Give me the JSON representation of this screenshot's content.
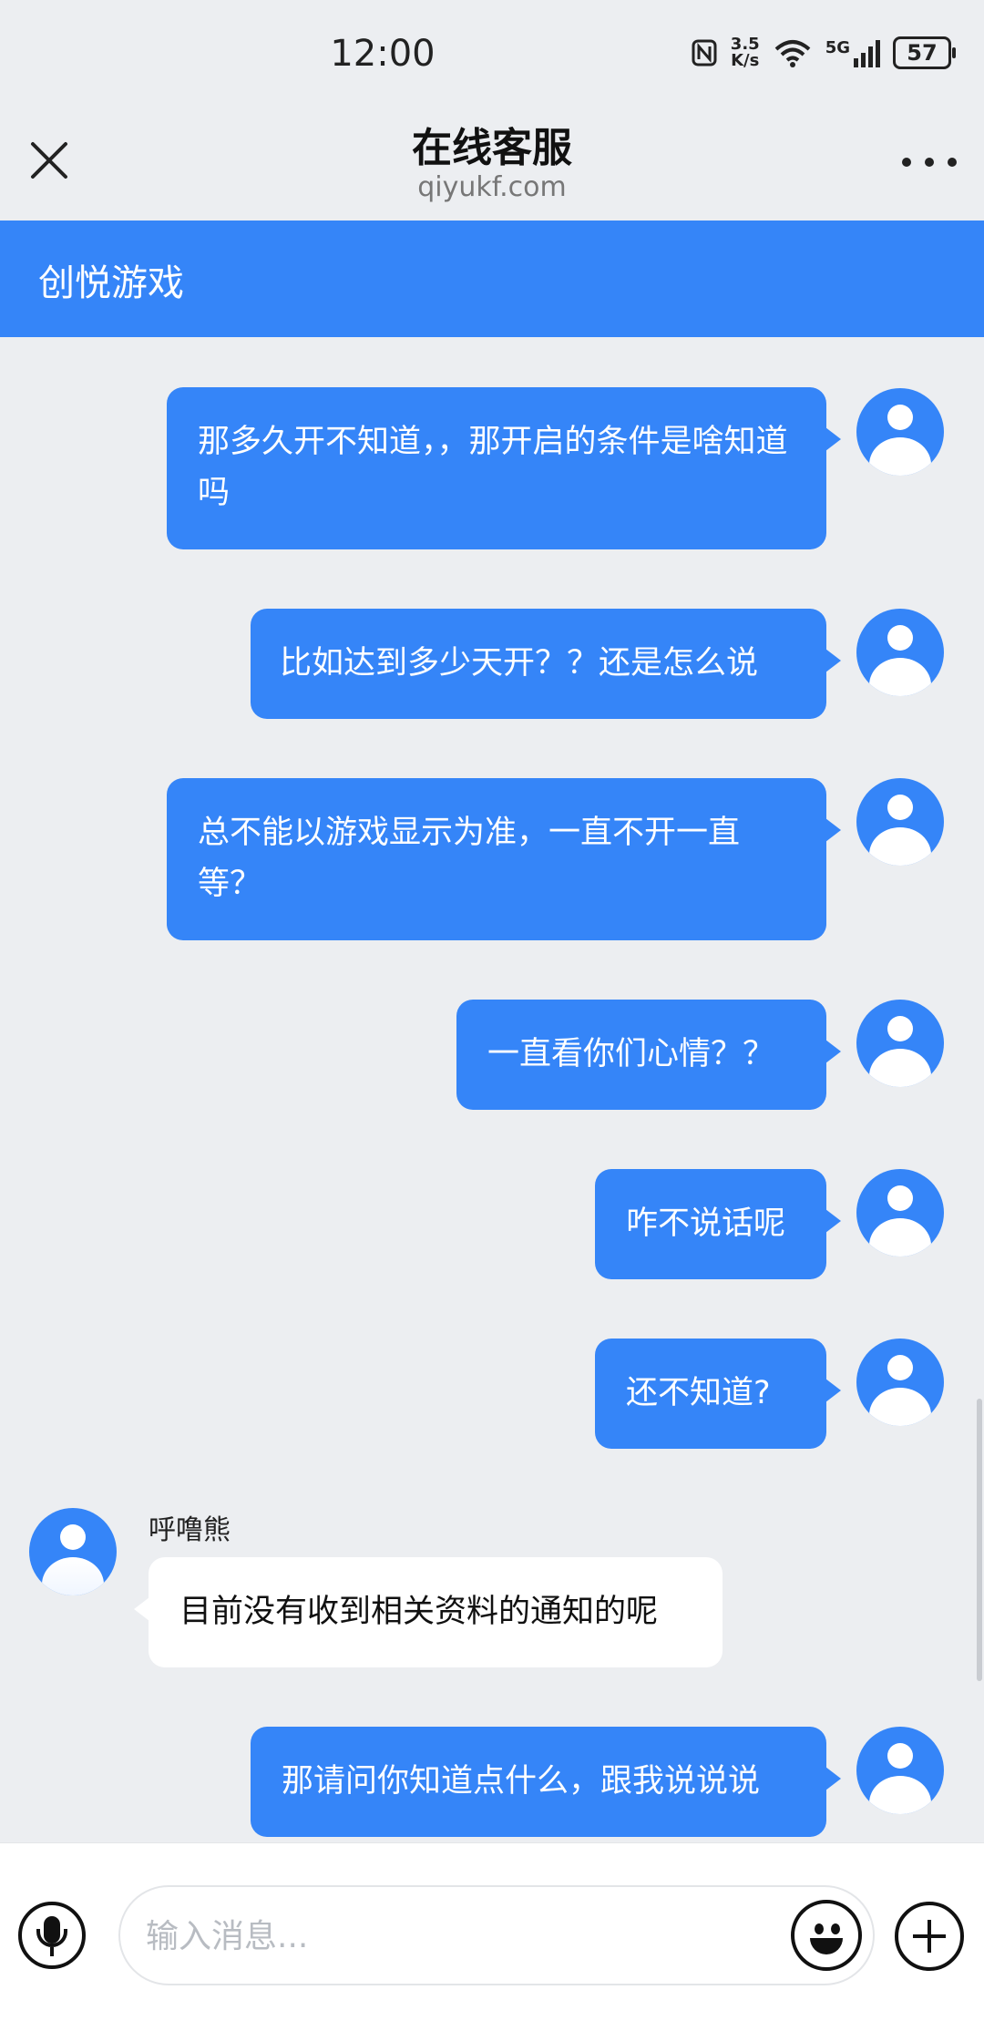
{
  "status_bar": {
    "time": "12:00",
    "net_speed_value": "3.5",
    "net_speed_unit": "K/s",
    "signal_label": "5G",
    "battery": "57"
  },
  "header": {
    "title": "在线客服",
    "subtitle": "qiyukf.com"
  },
  "brand": {
    "name": "创悦游戏",
    "color": "#3585f8"
  },
  "messages": [
    {
      "side": "right",
      "text": "那多久开不知道，，那开启的条件是啥知道吗"
    },
    {
      "side": "right",
      "text": "比如达到多少天开？？还是怎么说"
    },
    {
      "side": "right",
      "text": "总不能以游戏显示为准，一直不开一直等？"
    },
    {
      "side": "right",
      "text": "一直看你们心情？？"
    },
    {
      "side": "right",
      "text": "咋不说话呢"
    },
    {
      "side": "right",
      "text": "还不知道?"
    },
    {
      "side": "left",
      "sender": "呼噜熊",
      "text": "目前没有收到相关资料的通知的呢"
    },
    {
      "side": "right",
      "text": "那请问你知道点什么，跟我说说说"
    }
  ],
  "input": {
    "placeholder": "输入消息..."
  },
  "icons": {
    "close": "close-icon",
    "more": "more-icon",
    "mic": "microphone-icon",
    "emoji": "emoji-icon",
    "plus": "plus-icon",
    "avatar": "user-avatar-icon"
  }
}
